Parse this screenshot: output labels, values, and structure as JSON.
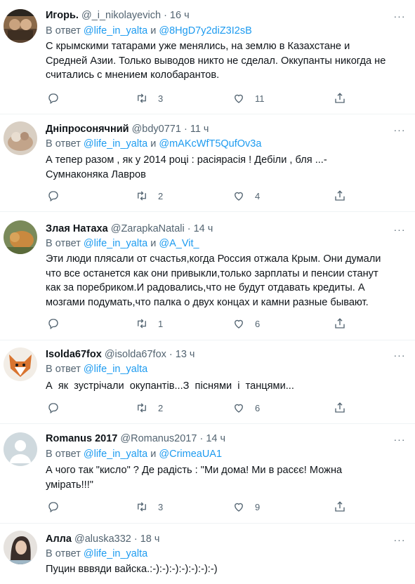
{
  "tweets": [
    {
      "name": "Игорь.",
      "handle": "@_i_nikolayevich",
      "time": "· 16 ч",
      "reply_prefix": "В ответ",
      "reply_user1": "@life_in_yalta",
      "reply_and": " и ",
      "reply_user2": "@8HgD7y2diZ3I2sB",
      "text": "С крымскими татарами уже менялись, на землю в Казахстане и\nСредней Азии. Только выводов никто не сделал. Оккупанты никогда не\nсчитались с мнением колобарантов.",
      "retweets": "3",
      "likes": "11"
    },
    {
      "name": "Дніпросонячний",
      "handle": "@bdy0771",
      "time": "· 11 ч",
      "reply_prefix": "В ответ",
      "reply_user1": "@life_in_yalta",
      "reply_and": " и ",
      "reply_user2": "@mAKcWfT5QufOv3a",
      "text": "А тепер разом , як у 2014 році : расіярасія ! Дебіли , бля ...-\nСумнаконяка Лавров",
      "retweets": "2",
      "likes": "4"
    },
    {
      "name": "Злая Натаха",
      "handle": "@ZarapkaNatali",
      "time": "· 14 ч",
      "reply_prefix": "В ответ",
      "reply_user1": "@life_in_yalta",
      "reply_and": " и ",
      "reply_user2": "@A_Vit_",
      "text": "Эти люди плясали от счастья,когда Россия отжала Крым. Они думали\nчто все останется как они привыкли,только зарплаты и пенсии станут\nкак за поребриком.И радовались,что не будут отдавать кредиты. А\nмозгами подумать,что палка о двух концах и камни разные бывают.",
      "retweets": "1",
      "likes": "6"
    },
    {
      "name": "Isolda67fox",
      "handle": "@isolda67fox",
      "time": "· 13 ч",
      "reply_prefix": "В ответ",
      "reply_user1": "@life_in_yalta",
      "reply_and": "",
      "reply_user2": "",
      "text": "А  як  зустрічали  окупантів...З  піснями  і  танцями...",
      "retweets": "2",
      "likes": "6"
    },
    {
      "name": "Romanus 2017",
      "handle": "@Romanus2017",
      "time": "· 14 ч",
      "reply_prefix": "В ответ",
      "reply_user1": "@life_in_yalta",
      "reply_and": " и ",
      "reply_user2": "@CrimeaUA1",
      "text": "А чого так \"кисло\" ? Де радість : \"Ми дома! Ми в расєє! Можна\nумірать!!!\"",
      "retweets": "3",
      "likes": "9"
    },
    {
      "name": "Алла",
      "handle": "@aluska332",
      "time": "· 18 ч",
      "reply_prefix": "В ответ",
      "reply_user1": "@life_in_yalta",
      "reply_and": "",
      "reply_user2": "",
      "text": "Пуцин вввяди вайска.:-):-):-):-):-):-):-)",
      "retweets": "",
      "likes": ""
    }
  ],
  "more_glyph": "···",
  "colors": {
    "link": "#1d9bf0",
    "muted": "#536471",
    "text": "#0f1419",
    "divider": "#eff3f4"
  },
  "icons": [
    "reply-icon",
    "retweet-icon",
    "like-icon",
    "share-icon",
    "more-icon"
  ]
}
